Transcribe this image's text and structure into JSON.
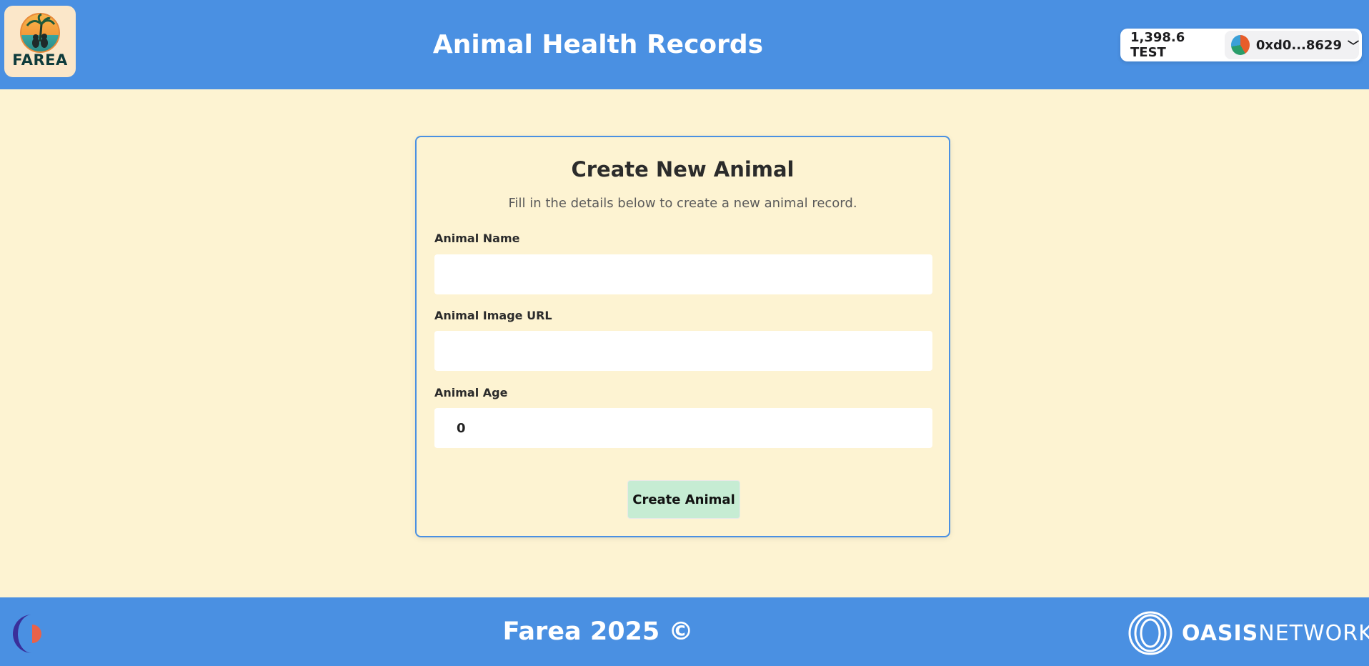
{
  "header": {
    "logo_text": "FAREA",
    "title": "Animal Health Records",
    "wallet": {
      "balance": "1,398.6 TEST",
      "address": "0xd0...8629",
      "chevron": "﹀"
    }
  },
  "form": {
    "title": "Create New Animal",
    "subtitle": "Fill in the details below to create a new animal record.",
    "name_label": "Animal Name",
    "name_value": "",
    "image_label": "Animal Image URL",
    "image_value": "",
    "age_label": "Animal Age",
    "age_value": "0",
    "submit_label": "Create Animal"
  },
  "footer": {
    "text": "Farea 2025 ©",
    "oasis_bold": "OASIS",
    "oasis_light": "NETWORK"
  },
  "colors": {
    "primary": "#4a90e2",
    "background": "#fdf3d2",
    "button": "#c6ecd3",
    "crescent": "#3a2f9a",
    "crescent_accent": "#e8624a"
  },
  "icons": {
    "logo": "palm-tree-cat-dog-logo",
    "avatar": "wallet-avatar-icon",
    "footer_left": "crescent-logo-icon",
    "footer_right": "oasis-rings-icon"
  }
}
